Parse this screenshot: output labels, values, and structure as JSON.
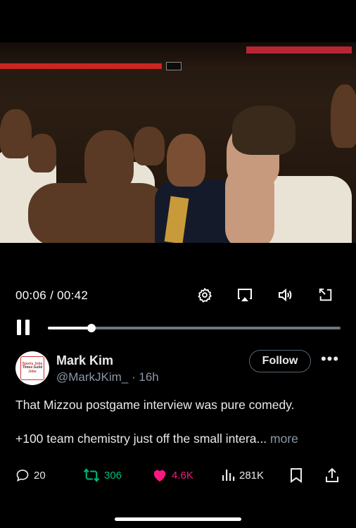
{
  "player": {
    "current_time": "00:06",
    "separator": " / ",
    "duration": "00:42",
    "progress_fraction": 0.15,
    "scoreboard_text": "00:0"
  },
  "author": {
    "name": "Mark Kim",
    "handle": "@MarkJKim_",
    "time_ago": "16h",
    "avatar_text": [
      "Sports Jobs",
      "Times Guild",
      "Jobs"
    ],
    "follow_label": "Follow"
  },
  "post": {
    "line1": "That Mizzou postgame interview was pure comedy.",
    "line2": "+100 team chemistry just off the small intera...",
    "more_label": "more"
  },
  "actions": {
    "replies": "20",
    "reposts": "306",
    "likes": "4.6K",
    "views": "281K"
  },
  "colors": {
    "background": "#000000",
    "repost_green": "#00ba7c",
    "like_pink": "#f91880",
    "muted": "#8b98a5"
  }
}
